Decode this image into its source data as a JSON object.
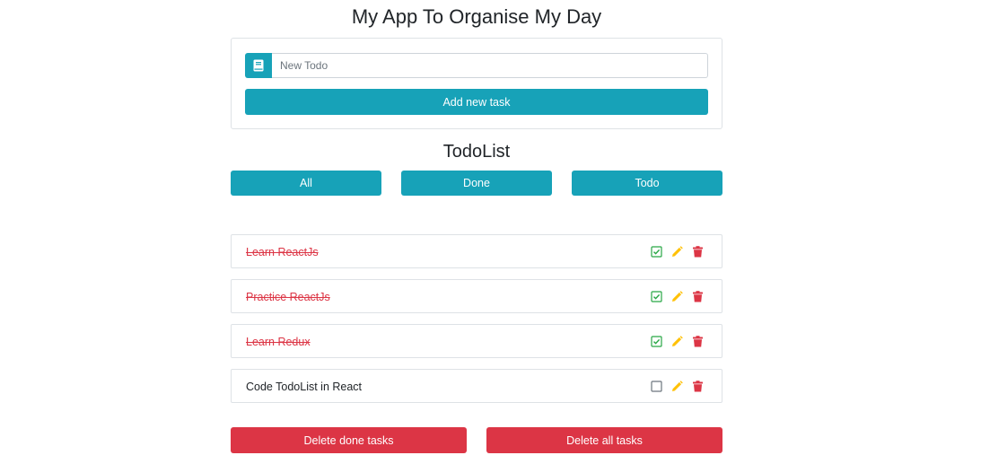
{
  "header": {
    "title": "My App To Organise My Day"
  },
  "new_todo": {
    "placeholder": "New Todo",
    "value": "",
    "input_icon": "book-icon",
    "add_label": "Add new task"
  },
  "list": {
    "title": "TodoList",
    "filters": [
      {
        "label": "All"
      },
      {
        "label": "Done"
      },
      {
        "label": "Todo"
      }
    ],
    "tasks": [
      {
        "label": "Learn ReactJs",
        "done": true
      },
      {
        "label": "Practice ReactJs",
        "done": true
      },
      {
        "label": "Learn Redux",
        "done": true
      },
      {
        "label": "Code TodoList in React",
        "done": false
      }
    ],
    "actions": {
      "check_icon": "checkbox-icon",
      "edit_icon": "pencil-icon",
      "delete_icon": "trash-icon"
    }
  },
  "footer": {
    "delete_done_label": "Delete done tasks",
    "delete_all_label": "Delete all tasks"
  },
  "colors": {
    "primary": "#17a2b8",
    "danger": "#dc3545",
    "warning": "#ffc107",
    "success": "#28a745"
  }
}
